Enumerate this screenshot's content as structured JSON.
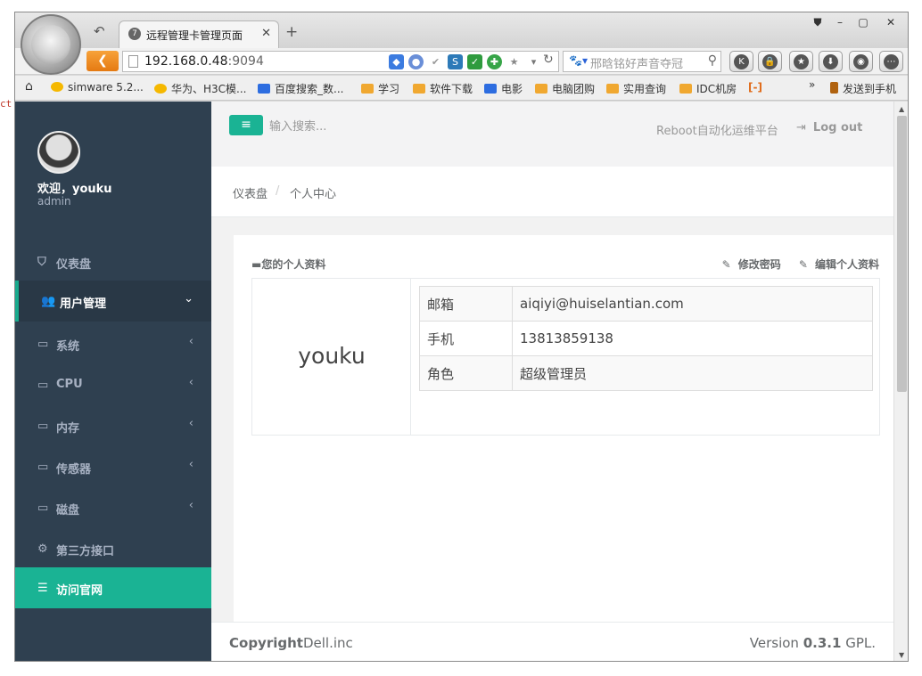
{
  "browser": {
    "tab_title": "远程管理卡管理页面",
    "tab_favicon": "7",
    "url_host": "192.168.0.48",
    "url_port": ":9094",
    "search_text": "邢晗铭好声音夺冠",
    "search_engine_glyph": "🐾▾",
    "user_button_badge": "K",
    "window_controls": [
      "⛊",
      "–",
      "▢",
      "✕"
    ]
  },
  "bookmarks": [
    {
      "label": "simware 5.2...",
      "icon": "z-icon"
    },
    {
      "label": "华为、H3C模...",
      "icon": "z-icon"
    },
    {
      "label": "百度搜索_数...",
      "icon": "baidu-paw-icon"
    },
    {
      "label": "学习",
      "icon": "folder-icon"
    },
    {
      "label": "软件下载",
      "icon": "folder-icon"
    },
    {
      "label": "电影",
      "icon": "baidu-paw-icon"
    },
    {
      "label": "电脑团购",
      "icon": "folder-icon"
    },
    {
      "label": "实用查询",
      "icon": "folder-icon"
    },
    {
      "label": "IDC机房",
      "icon": "folder-icon"
    },
    {
      "label": "»",
      "icon": "overflow"
    },
    {
      "label": "发送到手机",
      "icon": "phone-icon"
    }
  ],
  "desktop_fragment": "ct",
  "sidebar": {
    "welcome": "欢迎，youku",
    "role": "admin",
    "items": [
      {
        "label": "仪表盘",
        "icon": "dashboard-icon",
        "chevron": ""
      },
      {
        "label": "用户管理",
        "icon": "users-icon",
        "chevron": "⌄"
      },
      {
        "label": "系统",
        "icon": "hdd-icon",
        "chevron": "‹"
      },
      {
        "label": "CPU",
        "icon": "hdd-icon",
        "chevron": "‹"
      },
      {
        "label": "内存",
        "icon": "hdd-icon",
        "chevron": "‹"
      },
      {
        "label": "传感器",
        "icon": "hdd-icon",
        "chevron": "‹"
      },
      {
        "label": "磁盘",
        "icon": "hdd-icon",
        "chevron": "‹"
      },
      {
        "label": "第三方接口",
        "icon": "cogs-icon",
        "chevron": ""
      },
      {
        "label": "访问官网",
        "icon": "database-icon",
        "chevron": ""
      }
    ]
  },
  "topbar": {
    "menu_button": "≡",
    "search_placeholder": "输入搜索...",
    "platform_name": "Reboot自动化运维平台",
    "logout": "Log out"
  },
  "breadcrumb": {
    "items": [
      "仪表盘",
      "个人中心"
    ],
    "separator": "/"
  },
  "profile": {
    "title": "您的个人资料",
    "change_password": "修改密码",
    "edit_profile": "编辑个人资料",
    "username": "youku",
    "rows": [
      {
        "key": "邮箱",
        "value": "aiqiyi@huiselantian.com"
      },
      {
        "key": "手机",
        "value": "13813859138"
      },
      {
        "key": "角色",
        "value": "超级管理员"
      }
    ]
  },
  "footer": {
    "copyright_bold": "Copyright",
    "copyright_rest": "Dell.inc",
    "version_prefix": "Version ",
    "version_number": "0.3.1",
    "version_suffix": " GPL."
  },
  "colors": {
    "sidebar_bg": "#2f4050",
    "accent": "#1ab394",
    "browser_back": "#e57a12"
  }
}
